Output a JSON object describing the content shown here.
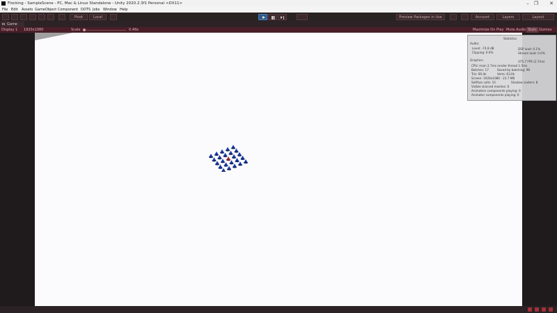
{
  "window": {
    "title": "Flocking - SampleScene - PC, Mac & Linux Standalone - Unity 2020.2.3f1 Personal <DX11>",
    "controls": [
      "–",
      "❐",
      "✕"
    ]
  },
  "menu": [
    "File",
    "Edit",
    "Assets",
    "GameObject",
    "Component",
    "DOTS",
    "Jobs",
    "Window",
    "Help"
  ],
  "toolbar": {
    "pivot_label": "Pivot",
    "local_label": "Local",
    "packages_label": "Preview Packages in Use",
    "account_label": "Account",
    "layers_label": "Layers",
    "layout_label": "Layout"
  },
  "game_tab": {
    "label": "Game"
  },
  "game_toolbar": {
    "display": "Display 1",
    "resolution": "1920x1080",
    "scale_label": "Scale",
    "scale_value": "0.48x",
    "maximize": "Maximize On Play",
    "mute": "Mute Audio",
    "stats": "Stats",
    "gizmos": "Gizmos"
  },
  "statistics": {
    "title": "Statistics",
    "audio_header": "Audio:",
    "level": "Level: -74.8 dB",
    "clipping": "Clipping: 0.0%",
    "dsp_load": "DSP load: 0.1%",
    "stream_load": "Stream load: 0.0%",
    "graphics_header": "Graphics:",
    "fps": "375.7 FPS (2.7ms)",
    "cpu": "CPU: main 2.7ms  render thread 1.5ms",
    "batches": "Batches: 17",
    "saved_batching": "Saved by batching: 96",
    "tris": "Tris: 69.4k",
    "verts": "Verts: 63.0k",
    "screen": "Screen: 1920x1080 - 23.7 MB",
    "setpass": "SetPass calls: 15",
    "shadow_casters": "Shadow casters: 8",
    "skinned": "Visible skinned meshes: 0",
    "anim_playing": "Animation components playing: 0",
    "animator_playing": "Animator components playing: 0"
  },
  "colors": {
    "accent": "#4a1e28",
    "play_active": "#2c5a8a",
    "boid": "#1e3fb0",
    "leader": "#b03030"
  }
}
